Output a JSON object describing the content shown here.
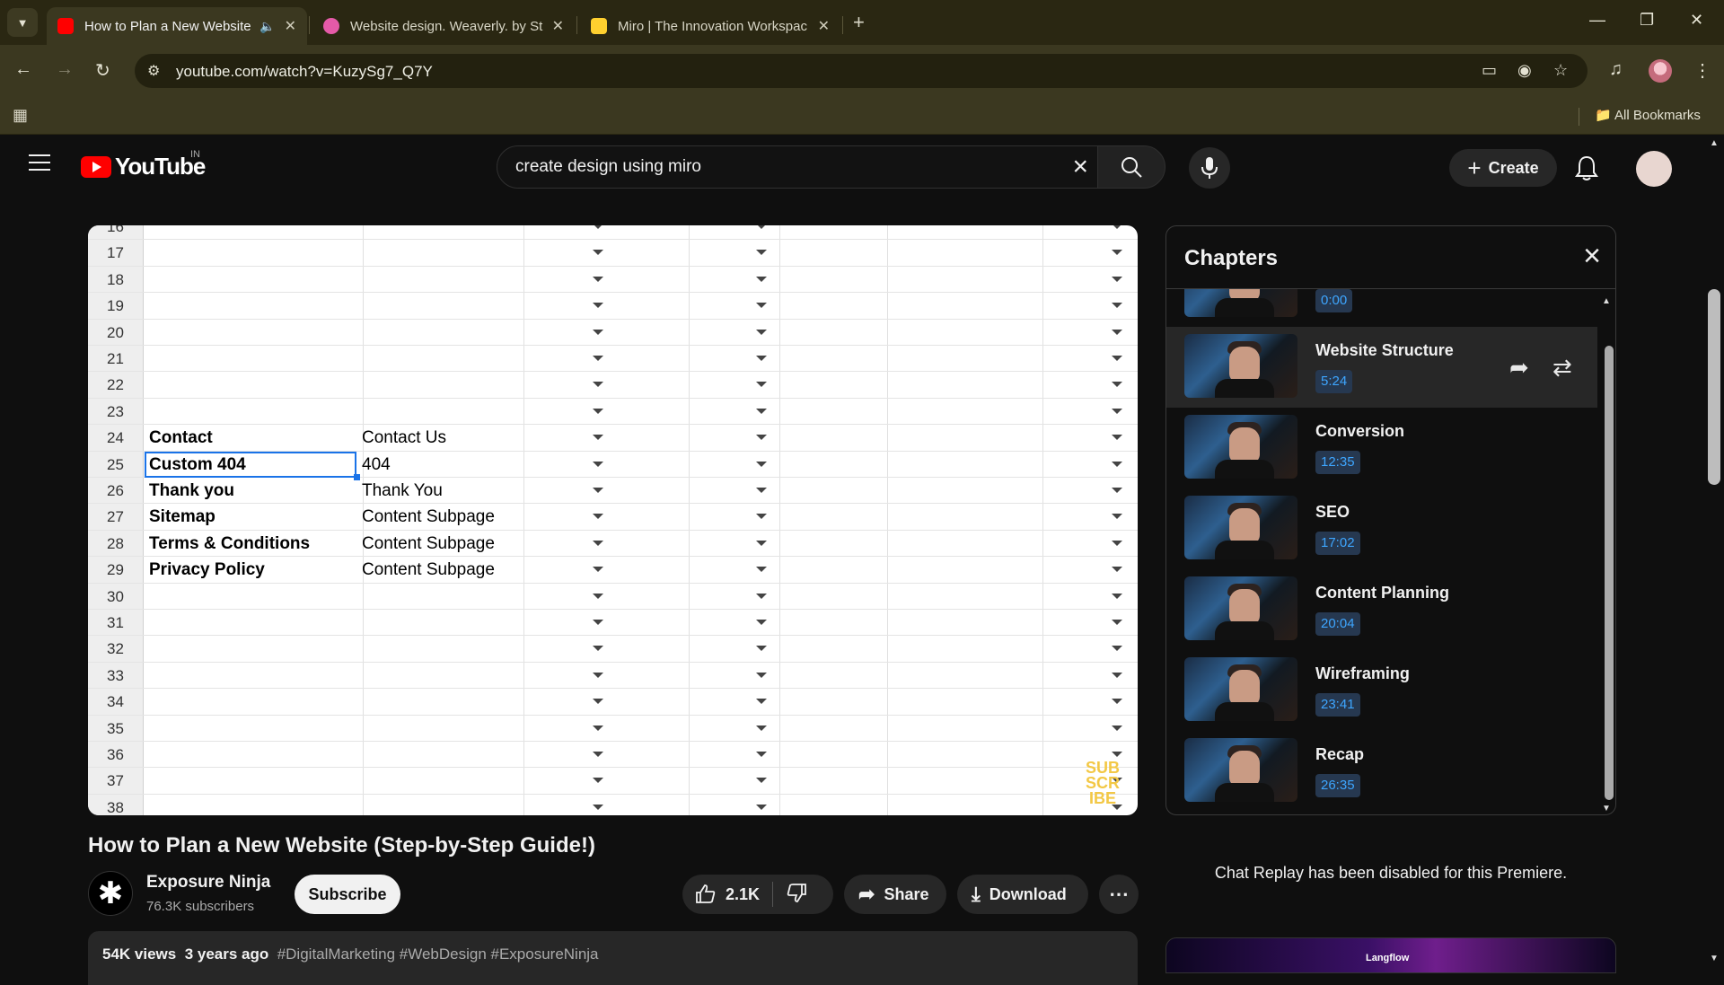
{
  "browser": {
    "tabs": [
      {
        "title": "How to Plan a New Website",
        "favicon_color": "#ff0000",
        "active": true
      },
      {
        "title": "Website design. Weaverly. by St",
        "favicon_color": "#e55aa8",
        "active": false
      },
      {
        "title": "Miro | The Innovation Workspac",
        "favicon_color": "#ffd02f",
        "active": false
      }
    ],
    "url": "youtube.com/watch?v=KuzySg7_Q7Y",
    "bookmarks_label": "All Bookmarks"
  },
  "youtube": {
    "logo_text": "YouTube",
    "country": "IN",
    "search_query": "create design using miro",
    "create_label": "Create"
  },
  "spreadsheet": {
    "rows": [
      {
        "n": "16",
        "a": "",
        "b": ""
      },
      {
        "n": "17",
        "a": "",
        "b": ""
      },
      {
        "n": "18",
        "a": "",
        "b": ""
      },
      {
        "n": "19",
        "a": "",
        "b": ""
      },
      {
        "n": "20",
        "a": "",
        "b": ""
      },
      {
        "n": "21",
        "a": "",
        "b": ""
      },
      {
        "n": "22",
        "a": "",
        "b": ""
      },
      {
        "n": "23",
        "a": "",
        "b": ""
      },
      {
        "n": "24",
        "a": "Contact",
        "b": "Contact Us"
      },
      {
        "n": "25",
        "a": "Custom 404",
        "b": "404"
      },
      {
        "n": "26",
        "a": "Thank you",
        "b": "Thank You"
      },
      {
        "n": "27",
        "a": "Sitemap",
        "b": "Content Subpage"
      },
      {
        "n": "28",
        "a": "Terms & Conditions",
        "b": "Content Subpage"
      },
      {
        "n": "29",
        "a": "Privacy Policy",
        "b": "Content Subpage"
      },
      {
        "n": "30",
        "a": "",
        "b": ""
      },
      {
        "n": "31",
        "a": "",
        "b": ""
      },
      {
        "n": "32",
        "a": "",
        "b": ""
      },
      {
        "n": "33",
        "a": "",
        "b": ""
      },
      {
        "n": "34",
        "a": "",
        "b": ""
      },
      {
        "n": "35",
        "a": "",
        "b": ""
      },
      {
        "n": "36",
        "a": "",
        "b": ""
      },
      {
        "n": "37",
        "a": "",
        "b": ""
      },
      {
        "n": "38",
        "a": "",
        "b": ""
      }
    ],
    "watermark": "SUB SCR IBE"
  },
  "video": {
    "title": "How to Plan a New Website (Step-by-Step Guide!)",
    "channel_name": "Exposure Ninja",
    "subscribers": "76.3K subscribers",
    "subscribe_label": "Subscribe",
    "likes": "2.1K",
    "share_label": "Share",
    "download_label": "Download",
    "views": "54K views",
    "age": "3 years ago",
    "tags": "#DigitalMarketing #WebDesign #ExposureNinja"
  },
  "chapters": {
    "title": "Chapters",
    "items": [
      {
        "name": "",
        "time": "0:00"
      },
      {
        "name": "Website Structure",
        "time": "5:24"
      },
      {
        "name": "Conversion",
        "time": "12:35"
      },
      {
        "name": "SEO",
        "time": "17:02"
      },
      {
        "name": "Content Planning",
        "time": "20:04"
      },
      {
        "name": "Wireframing",
        "time": "23:41"
      },
      {
        "name": "Recap",
        "time": "26:35"
      }
    ]
  },
  "chat_note": "Chat Replay has been disabled for this Premiere.",
  "next_card_label": "Langflow"
}
